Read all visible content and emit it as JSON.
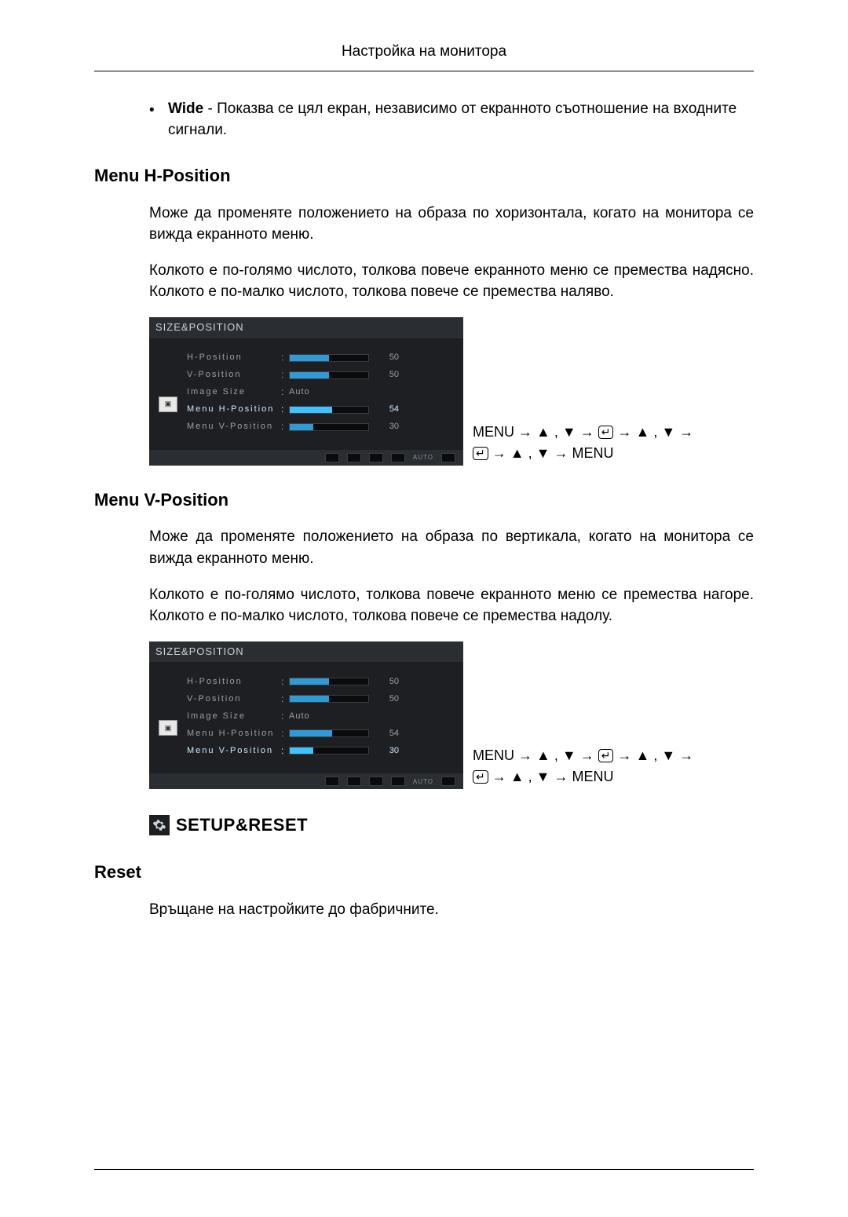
{
  "header": {
    "running": "Настройка на монитора"
  },
  "wide": {
    "label": "Wide",
    "text": " - Показва се цял екран, независимо от екранното съотношение на входните сигнали."
  },
  "menu_h": {
    "title": "Menu H-Position",
    "p1": "Може да променяте положението на образа по хоризонтала, когато на монитора се вижда екранното меню.",
    "p2": "Колкото е по-голямо числото, толкова повече екранното меню се премества надясно. Колкото е по-малко числото, толкова повече се премества наляво."
  },
  "menu_v": {
    "title": "Menu V-Position",
    "p1": "Може да променяте положението на образа по вертикала, когато на монитора се вижда екранното меню.",
    "p2": "Колкото е по-голямо числото, толкова повече екранното меню се премества нагоре. Колкото е по-малко числото, толкова повече се премества надолу."
  },
  "osd": {
    "title": "SIZE&POSITION",
    "rows": {
      "hpos": {
        "label": "H-Position",
        "value": "50",
        "fill": 50
      },
      "vpos": {
        "label": "V-Position",
        "value": "50",
        "fill": 50
      },
      "isize": {
        "label": "Image Size",
        "text": "Auto"
      },
      "mhpos": {
        "label": "Menu H-Position",
        "value": "54",
        "fill": 54
      },
      "mvpos": {
        "label": "Menu V-Position",
        "value": "30",
        "fill": 30
      }
    },
    "nav_auto": "AUTO"
  },
  "nav": {
    "word_menu": "MENU",
    "arrow": "→",
    "up": "▲",
    "down": "▼",
    "comma": " , ",
    "enter": "↵"
  },
  "setup": {
    "title": "SETUP&RESET",
    "reset_title": "Reset",
    "reset_text": "Връщане на настройките до фабричните."
  }
}
